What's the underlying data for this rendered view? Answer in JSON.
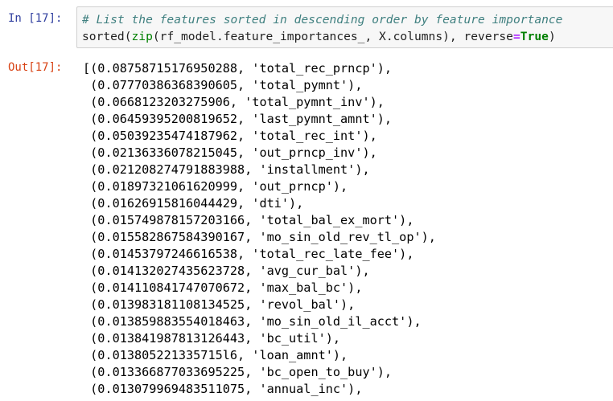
{
  "input_cell": {
    "prompt": "In [17]:",
    "comment": "# List the features sorted in descending order by feature importance",
    "code_prefix": "sorted",
    "code_mid1": "(",
    "code_zip": "zip",
    "code_mid2": "(rf_model.feature_importances_, X.columns), reverse",
    "code_eq": "=",
    "code_true": "True",
    "code_end": ")"
  },
  "output_cell": {
    "prompt": "Out[17]:",
    "lines": [
      "[(0.08758715176950288, 'total_rec_prncp'),",
      " (0.0777038636839060​5, 'total_pymnt'),",
      " (0.0668123203275906, 'total_pymnt_inv'),",
      " (0.06459395200819652, 'last_pymnt_amnt'),",
      " (0.05039235474187962, 'total_rec_int'),",
      " (0.02136336078215045, 'out_prncp_inv'),",
      " (0.021208274791883988, 'installment'),",
      " (0.01897321061620999, 'out_prncp'),",
      " (0.01626915816044429, 'dti'),",
      " (0.015749878157203166, 'total_bal_ex_mort'),",
      " (0.015582867584390167, 'mo_sin_old_rev_tl_op'),",
      " (0.01453797246616538, 'total_rec_late_fee'),",
      " (0.014132027435623728, 'avg_cur_bal'),",
      " (0.014110841747070672, 'max_bal_bc'),",
      " (0.013983181108134525, 'revol_bal'),",
      " (0.013859883554018463, 'mo_sin_old_il_acct'),",
      " (0.013841987813126443, 'bc_util'),",
      " (0.013805221335715l6, 'loan_amnt'),",
      " (0.013366877033695225, 'bc_open_to_buy'),",
      " (0.013079969483511075, 'annual_inc'),"
    ]
  }
}
